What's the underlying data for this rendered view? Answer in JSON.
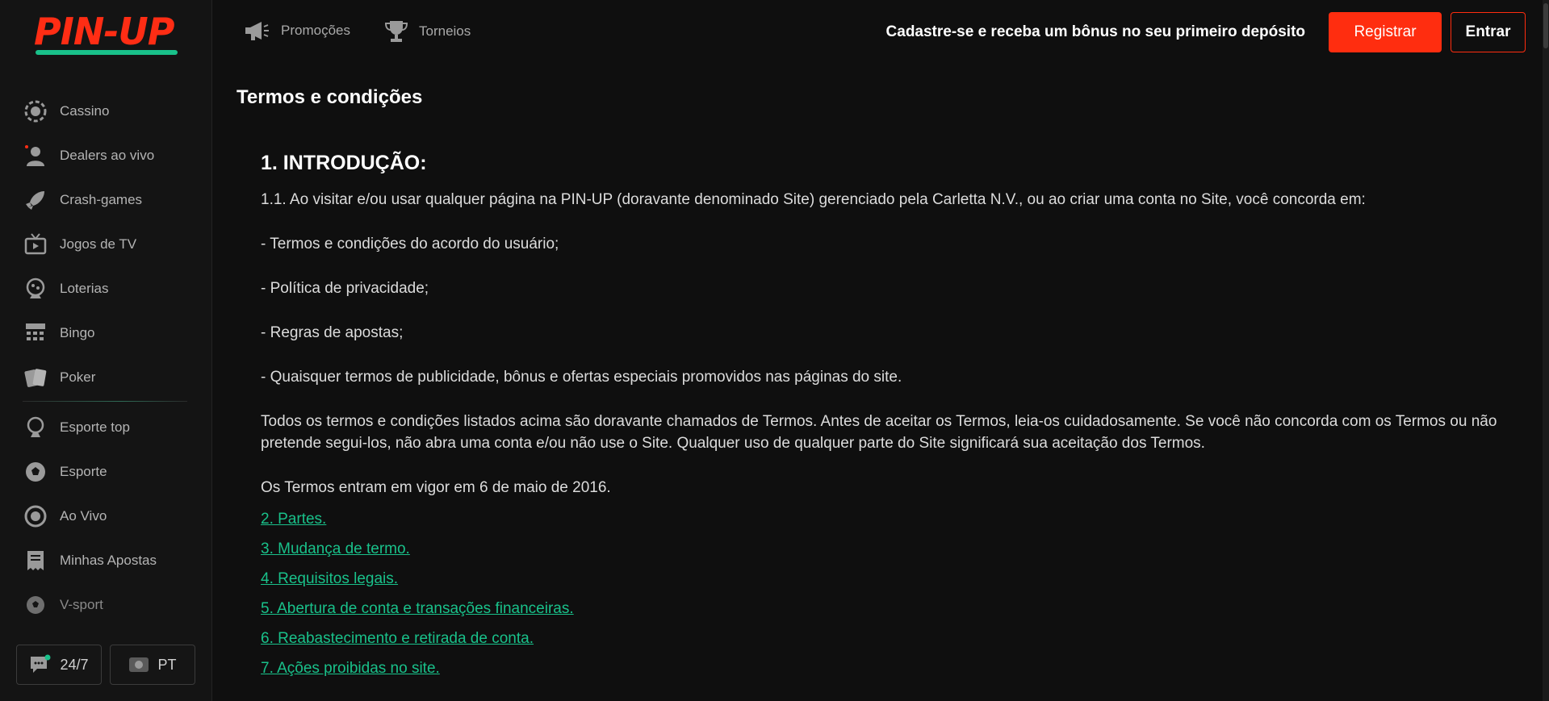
{
  "brand": {
    "logo_text": "PIN-UP",
    "accent": "#ff2d14",
    "green": "#19c18a"
  },
  "sidebar": {
    "items": [
      {
        "label": "Cassino",
        "icon": "casino-chip-icon"
      },
      {
        "label": "Dealers ao vivo",
        "icon": "live-dealer-icon"
      },
      {
        "label": "Crash-games",
        "icon": "rocket-icon"
      },
      {
        "label": "Jogos de TV",
        "icon": "tv-icon"
      },
      {
        "label": "Loterias",
        "icon": "lottery-icon"
      },
      {
        "label": "Bingo",
        "icon": "bingo-icon"
      },
      {
        "label": "Poker",
        "icon": "poker-cards-icon"
      }
    ],
    "items2": [
      {
        "label": "Esporte top",
        "icon": "trophy-ball-icon"
      },
      {
        "label": "Esporte",
        "icon": "soccer-ball-icon"
      },
      {
        "label": "Ao Vivo",
        "icon": "live-target-icon"
      },
      {
        "label": "Minhas Apostas",
        "icon": "receipt-icon"
      },
      {
        "label": "V-sport",
        "icon": "virtual-sport-icon"
      }
    ],
    "support_label": "24/7",
    "lang_label": "PT"
  },
  "header": {
    "promotions": "Promoções",
    "tournaments": "Torneios",
    "promo_text": "Cadastre-se e receba um bônus no seu primeiro depósito",
    "register": "Registrar",
    "login": "Entrar"
  },
  "main": {
    "page_title": "Termos e condições",
    "section_title": "1. INTRODUÇÃO:",
    "paragraphs": [
      "1.1. Ao visitar e/ou usar qualquer página na PIN-UP (doravante denominado Site) gerenciado pela Carletta N.V., ou ao criar uma conta no Site, você concorda em:",
      "- Termos e condições do acordo do usuário;",
      "- Política de privacidade;",
      "- Regras de apostas;",
      "- Quaisquer termos de publicidade, bônus e ofertas especiais promovidos nas páginas do site.",
      "Todos os termos e condições listados acima são doravante chamados de Termos. Antes de aceitar os Termos, leia-os cuidadosamente. Se você não concorda com os Termos ou não pretende segui-los, não abra uma conta e/ou não use o Site. Qualquer uso de qualquer parte do Site significará sua aceitação dos Termos.",
      "Os Termos entram em vigor em 6 de maio de 2016."
    ],
    "toc": [
      "2. Partes.",
      "3. Mudança de termo.",
      "4. Requisitos legais.",
      "5. Abertura de conta e transações financeiras.",
      "6. Reabastecimento e retirada de conta.",
      "7. Ações proibidas no site."
    ]
  }
}
